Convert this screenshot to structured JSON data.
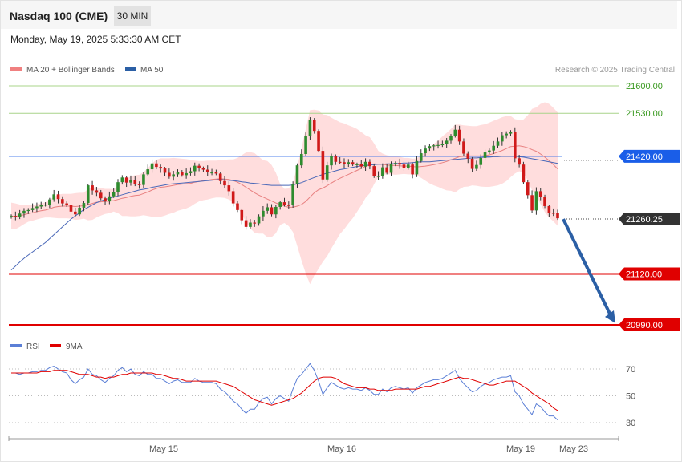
{
  "header": {
    "title": "Nasdaq 100 (CME)",
    "timeframe": "30 MIN"
  },
  "timestamp": "Monday, May 19, 2025 5:33:30 AM CET",
  "colors": {
    "up": "#2e8b2e",
    "down": "#d01a1a",
    "ma20": "#e88080",
    "bands": "#ffd7d7",
    "ma50": "#4a68b8",
    "rsi": "#5b7fd6",
    "rsi_ma": "#e00000",
    "resistance": "#a8d48a",
    "support": "#e00000",
    "pivot": "#1a5ee8",
    "arrow": "#2b5fa5"
  },
  "chart_data": [
    {
      "type": "candlestick",
      "legend": [
        {
          "name": "MA 20 + Bollinger Bands",
          "color": "#f08080"
        },
        {
          "name": "MA 50",
          "color": "#2b5fa5"
        }
      ],
      "legend_position": "top-left",
      "credit": "Research © 2025 Trading Central",
      "ylim": [
        20970,
        21650
      ],
      "x_ticks": [
        "May 15",
        "May 16",
        "May 19",
        "May 23"
      ],
      "levels": [
        {
          "value": 21600.0,
          "label": "21600.00",
          "kind": "resistance"
        },
        {
          "value": 21530.0,
          "label": "21530.00",
          "kind": "resistance"
        },
        {
          "value": 21420.0,
          "label": "21420.00",
          "kind": "pivot"
        },
        {
          "value": 21120.0,
          "label": "21120.00",
          "kind": "support"
        },
        {
          "value": 20990.0,
          "label": "20990.00",
          "kind": "support"
        }
      ],
      "last_price": {
        "value": 21260.25,
        "label": "21260.25"
      },
      "forecast_arrow": {
        "from": 21260,
        "to": 20990
      },
      "series": [
        {
          "name": "price",
          "values": [
            21268,
            21266,
            21274,
            21281,
            21283,
            21288,
            21292,
            21296,
            21297,
            21310,
            21323,
            21311,
            21300,
            21296,
            21279,
            21272,
            21289,
            21301,
            21346,
            21333,
            21327,
            21313,
            21305,
            21318,
            21328,
            21354,
            21366,
            21353,
            21360,
            21349,
            21347,
            21374,
            21387,
            21402,
            21393,
            21389,
            21378,
            21368,
            21374,
            21380,
            21372,
            21377,
            21382,
            21396,
            21390,
            21386,
            21379,
            21379,
            21376,
            21357,
            21346,
            21331,
            21300,
            21283,
            21257,
            21240,
            21251,
            21249,
            21267,
            21281,
            21290,
            21272,
            21291,
            21303,
            21296,
            21295,
            21349,
            21397,
            21426,
            21471,
            21512,
            21485,
            21434,
            21361,
            21397,
            21420,
            21406,
            21405,
            21400,
            21405,
            21399,
            21400,
            21394,
            21406,
            21395,
            21370,
            21370,
            21392,
            21378,
            21401,
            21403,
            21399,
            21391,
            21399,
            21374,
            21408,
            21428,
            21440,
            21446,
            21448,
            21449,
            21451,
            21460,
            21472,
            21488,
            21458,
            21427,
            21414,
            21388,
            21398,
            21416,
            21430,
            21435,
            21447,
            21458,
            21474,
            21478,
            21483,
            21415,
            21399,
            21354,
            21321,
            21282,
            21331,
            21316,
            21293,
            21276,
            21275,
            21262
          ]
        },
        {
          "name": "MA 20",
          "values": [
            21268,
            21267,
            21269,
            21271,
            21274,
            21276,
            21279,
            21281,
            21283,
            21286,
            21290,
            21292,
            21293,
            21293,
            21293,
            21292,
            21293,
            21294,
            21297,
            21300,
            21303,
            21304,
            21305,
            21306,
            21307,
            21310,
            21313,
            21315,
            21318,
            21320,
            21321,
            21325,
            21329,
            21334,
            21338,
            21341,
            21342,
            21344,
            21346,
            21348,
            21349,
            21350,
            21351,
            21354,
            21356,
            21358,
            21359,
            21361,
            21362,
            21363,
            21362,
            21361,
            21358,
            21354,
            21348,
            21341,
            21334,
            21327,
            21321,
            21316,
            21311,
            21306,
            21301,
            21297,
            21293,
            21290,
            21290,
            21293,
            21297,
            21305,
            21316,
            21327,
            21335,
            21339,
            21345,
            21352,
            21358,
            21364,
            21369,
            21374,
            21379,
            21384,
            21389,
            21394,
            21398,
            21401,
            21400,
            21400,
            21398,
            21397,
            21397,
            21396,
            21395,
            21395,
            21394,
            21393,
            21394,
            21395,
            21397,
            21399,
            21401,
            21404,
            21407,
            21411,
            21415,
            21419,
            21420,
            21421,
            21421,
            21421,
            21421,
            21422,
            21424,
            21427,
            21431,
            21435,
            21440,
            21445,
            21446,
            21447,
            21445,
            21442,
            21437,
            21433,
            21426,
            21418,
            21409,
            21399,
            21388
          ]
        },
        {
          "name": "BB upper",
          "values": [
            21302,
            21300,
            21297,
            21295,
            21295,
            21296,
            21298,
            21300,
            21303,
            21308,
            21317,
            21322,
            21324,
            21324,
            21324,
            21326,
            21327,
            21327,
            21337,
            21341,
            21341,
            21339,
            21337,
            21337,
            21336,
            21345,
            21357,
            21362,
            21369,
            21372,
            21373,
            21380,
            21390,
            21402,
            21411,
            21415,
            21415,
            21415,
            21416,
            21415,
            21414,
            21413,
            21411,
            21409,
            21408,
            21408,
            21409,
            21409,
            21409,
            21410,
            21411,
            21412,
            21412,
            21416,
            21423,
            21430,
            21431,
            21428,
            21419,
            21410,
            21408,
            21398,
            21378,
            21349,
            21337,
            21338,
            21353,
            21394,
            21440,
            21490,
            21538,
            21539,
            21537,
            21527,
            21526,
            21519,
            21513,
            21507,
            21504,
            21499,
            21495,
            21490,
            21482,
            21474,
            21469,
            21453,
            21434,
            21427,
            21423,
            21421,
            21421,
            21419,
            21416,
            21416,
            21414,
            21415,
            21423,
            21432,
            21443,
            21452,
            21460,
            21471,
            21480,
            21490,
            21501,
            21501,
            21499,
            21498,
            21497,
            21497,
            21500,
            21502,
            21506,
            21511,
            21515,
            21520,
            21523,
            21523,
            21515,
            21513,
            21514,
            21525,
            21541,
            21545,
            21554,
            21558,
            21554,
            21544,
            21532
          ]
        },
        {
          "name": "BB lower",
          "values": [
            21234,
            21234,
            21240,
            21247,
            21253,
            21256,
            21259,
            21262,
            21264,
            21264,
            21263,
            21262,
            21262,
            21262,
            21261,
            21258,
            21259,
            21261,
            21257,
            21258,
            21264,
            21269,
            21273,
            21275,
            21279,
            21275,
            21268,
            21268,
            21267,
            21267,
            21268,
            21270,
            21268,
            21266,
            21265,
            21266,
            21269,
            21273,
            21276,
            21281,
            21284,
            21287,
            21292,
            21299,
            21305,
            21308,
            21310,
            21313,
            21315,
            21315,
            21314,
            21310,
            21304,
            21292,
            21272,
            21253,
            21236,
            21225,
            21223,
            21223,
            21214,
            21214,
            21224,
            21245,
            21250,
            21242,
            21227,
            21191,
            21154,
            21121,
            21094,
            21116,
            21133,
            21151,
            21165,
            21185,
            21203,
            21222,
            21234,
            21249,
            21262,
            21278,
            21295,
            21314,
            21326,
            21349,
            21367,
            21373,
            21374,
            21374,
            21373,
            21374,
            21375,
            21374,
            21374,
            21371,
            21365,
            21358,
            21351,
            21346,
            21342,
            21337,
            21333,
            21332,
            21328,
            21336,
            21342,
            21343,
            21346,
            21345,
            21343,
            21342,
            21342,
            21344,
            21346,
            21350,
            21357,
            21367,
            21376,
            21382,
            21377,
            21359,
            21333,
            21321,
            21298,
            21278,
            21264,
            21254,
            21243
          ]
        },
        {
          "name": "MA 50",
          "values": [
            21130,
            21140,
            21150,
            21160,
            21168,
            21176,
            21184,
            21192,
            21200,
            21210,
            21220,
            21230,
            21240,
            21250,
            21260,
            21268,
            21276,
            21284,
            21290,
            21296,
            21302,
            21306,
            21310,
            21313,
            21316,
            21319,
            21322,
            21325,
            21328,
            21331,
            21334,
            21336,
            21338,
            21341,
            21343,
            21345,
            21347,
            21349,
            21350,
            21351,
            21352,
            21353,
            21354,
            21355,
            21356,
            21357,
            21358,
            21359,
            21360,
            21361,
            21360,
            21359,
            21358,
            21357,
            21355,
            21354,
            21352,
            21351,
            21350,
            21348,
            21347,
            21346,
            21346,
            21346,
            21346,
            21346,
            21347,
            21350,
            21353,
            21357,
            21362,
            21366,
            21370,
            21374,
            21377,
            21380,
            21383,
            21386,
            21388,
            21390,
            21392,
            21394,
            21396,
            21397,
            21398,
            21399,
            21400,
            21400,
            21401,
            21401,
            21402,
            21402,
            21403,
            21403,
            21404,
            21405,
            21406,
            21406,
            21406,
            21407,
            21408,
            21409,
            21410,
            21411,
            21412,
            21413,
            21414,
            21415,
            21416,
            21416,
            21417,
            21418,
            21418,
            21419,
            21419,
            21420,
            21420,
            21420,
            21420,
            21419,
            21418,
            21416,
            21414,
            21412,
            21410,
            21408,
            21406,
            21404,
            21402
          ]
        }
      ]
    },
    {
      "type": "line",
      "legend": [
        {
          "name": "RSI",
          "color": "#5b7fd6"
        },
        {
          "name": "9MA",
          "color": "#e00000"
        }
      ],
      "legend_position": "top-left",
      "ylim": [
        20,
        85
      ],
      "y_ticks": [
        70,
        50,
        30
      ],
      "series": [
        {
          "name": "RSI",
          "values": [
            67,
            67,
            66,
            67,
            67,
            68,
            68,
            69,
            69,
            71,
            72,
            70,
            68,
            67,
            62,
            59,
            62,
            64,
            70,
            66,
            65,
            62,
            60,
            63,
            65,
            69,
            71,
            68,
            70,
            66,
            65,
            68,
            66,
            66,
            63,
            63,
            61,
            59,
            61,
            62,
            60,
            60,
            60,
            63,
            61,
            60,
            60,
            60,
            59,
            55,
            53,
            50,
            46,
            44,
            40,
            37,
            40,
            40,
            45,
            48,
            49,
            44,
            48,
            50,
            48,
            46,
            55,
            63,
            66,
            70,
            74,
            69,
            61,
            51,
            56,
            60,
            58,
            56,
            55,
            56,
            55,
            55,
            54,
            56,
            54,
            51,
            51,
            55,
            53,
            56,
            57,
            56,
            55,
            56,
            52,
            56,
            58,
            60,
            61,
            62,
            62,
            63,
            65,
            67,
            69,
            63,
            59,
            56,
            53,
            54,
            57,
            59,
            60,
            62,
            63,
            64,
            64,
            65,
            53,
            50,
            44,
            40,
            36,
            44,
            42,
            38,
            35,
            35,
            32
          ]
        },
        {
          "name": "9MA",
          "values": [
            67,
            67,
            67,
            67,
            67,
            67,
            67,
            68,
            68,
            68,
            69,
            69,
            69,
            69,
            68,
            67,
            66,
            66,
            66,
            65,
            64,
            64,
            63,
            64,
            64,
            65,
            66,
            66,
            67,
            67,
            67,
            67,
            67,
            67,
            66,
            66,
            65,
            64,
            63,
            63,
            62,
            61,
            61,
            61,
            61,
            61,
            61,
            61,
            61,
            60,
            59,
            58,
            57,
            55,
            53,
            51,
            49,
            47,
            46,
            45,
            44,
            43,
            44,
            45,
            46,
            47,
            48,
            50,
            52,
            55,
            58,
            61,
            63,
            64,
            64,
            64,
            63,
            61,
            59,
            58,
            57,
            56,
            56,
            56,
            55,
            55,
            54,
            54,
            54,
            54,
            55,
            55,
            55,
            55,
            55,
            55,
            56,
            57,
            57,
            58,
            59,
            60,
            61,
            62,
            63,
            64,
            63,
            63,
            62,
            61,
            60,
            59,
            58,
            58,
            59,
            60,
            61,
            61,
            61,
            59,
            57,
            55,
            52,
            50,
            48,
            46,
            44,
            41,
            39
          ]
        }
      ]
    }
  ]
}
